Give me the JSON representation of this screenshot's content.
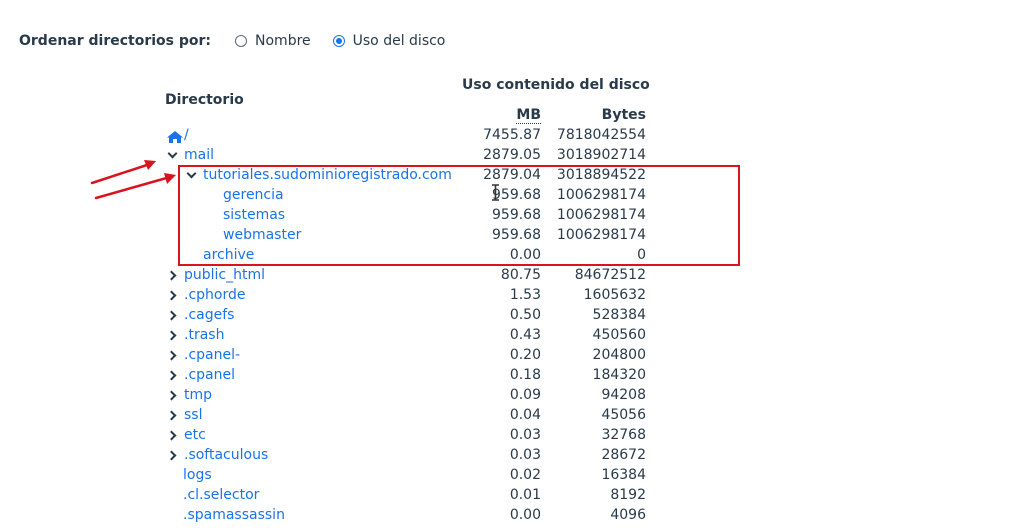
{
  "sort": {
    "label": "Ordenar directorios por:",
    "options": [
      {
        "label": "Nombre",
        "checked": false
      },
      {
        "label": "Uso del disco",
        "checked": true
      }
    ]
  },
  "table": {
    "header_dir": "Directorio",
    "header_usage": "Uso contenido del disco",
    "header_mb": "MB",
    "header_bytes": "Bytes",
    "rows": [
      {
        "name": "/",
        "mb": "7455.87",
        "bytes": "7818042554"
      },
      {
        "name": "mail",
        "mb": "2879.05",
        "bytes": "3018902714"
      },
      {
        "name": "tutoriales.sudominioregistrado.com",
        "mb": "2879.04",
        "bytes": "3018894522"
      },
      {
        "name": "gerencia",
        "mb": "959.68",
        "bytes": "1006298174"
      },
      {
        "name": "sistemas",
        "mb": "959.68",
        "bytes": "1006298174"
      },
      {
        "name": "webmaster",
        "mb": "959.68",
        "bytes": "1006298174"
      },
      {
        "name": "archive",
        "mb": "0.00",
        "bytes": "0"
      },
      {
        "name": "public_html",
        "mb": "80.75",
        "bytes": "84672512"
      },
      {
        "name": ".cphorde",
        "mb": "1.53",
        "bytes": "1605632"
      },
      {
        "name": ".cagefs",
        "mb": "0.50",
        "bytes": "528384"
      },
      {
        "name": ".trash",
        "mb": "0.43",
        "bytes": "450560"
      },
      {
        "name": ".cpanel-",
        "mb": "0.20",
        "bytes": "204800"
      },
      {
        "name": ".cpanel",
        "mb": "0.18",
        "bytes": "184320"
      },
      {
        "name": "tmp",
        "mb": "0.09",
        "bytes": "94208"
      },
      {
        "name": "ssl",
        "mb": "0.04",
        "bytes": "45056"
      },
      {
        "name": "etc",
        "mb": "0.03",
        "bytes": "32768"
      },
      {
        "name": ".softaculous",
        "mb": "0.03",
        "bytes": "28672"
      },
      {
        "name": "logs",
        "mb": "0.02",
        "bytes": "16384"
      },
      {
        "name": ".cl.selector",
        "mb": "0.01",
        "bytes": "8192"
      },
      {
        "name": ".spamassassin",
        "mb": "0.00",
        "bytes": "4096"
      }
    ]
  },
  "colors": {
    "link": "#1a73e8",
    "text": "#293a4a",
    "annotation": "#d9141f"
  }
}
